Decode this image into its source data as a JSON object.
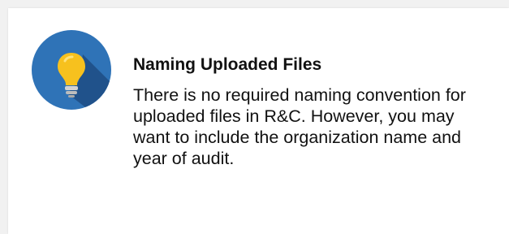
{
  "tip": {
    "icon": "lightbulb-icon",
    "title": "Naming Uploaded Files",
    "body": "There is no required naming convention for uploaded files in R&C. However, you may want to include the organization name and year of audit."
  },
  "colors": {
    "circle": "#2f73b7",
    "shadow": "#1f4f86",
    "bulb": "#f7c11e",
    "bulb_base": "#c8c8c8",
    "text": "#111111",
    "card": "#ffffff",
    "background": "#f1f1f1"
  }
}
